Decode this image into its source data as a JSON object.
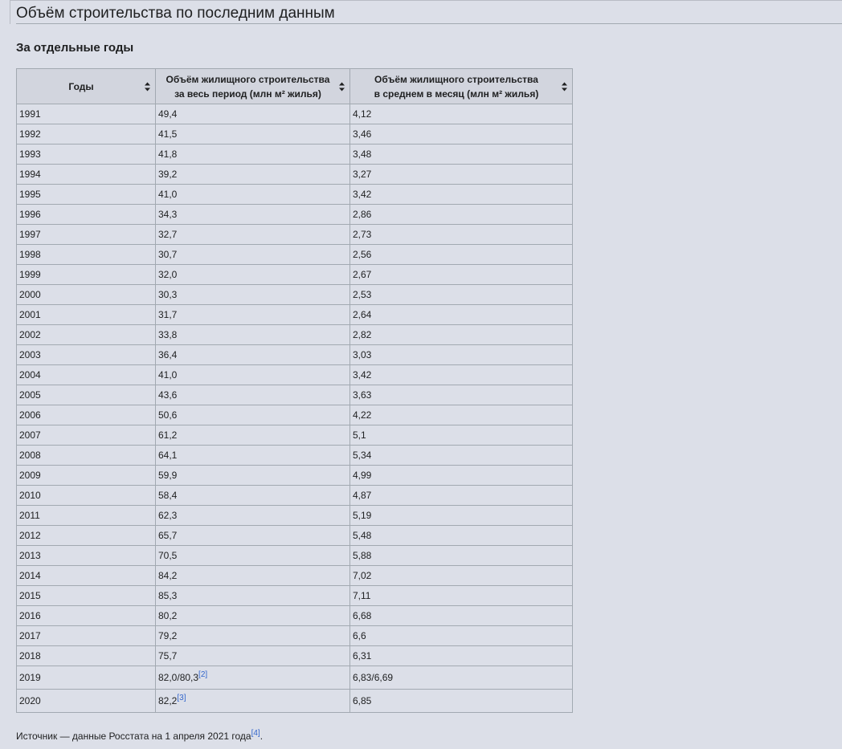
{
  "section_title": "Объём строительства по последним данным",
  "subsection_title": "За отдельные годы",
  "table": {
    "headers": [
      {
        "line1": "Годы",
        "line2": ""
      },
      {
        "line1": "Объём жилищного строительства",
        "line2": "за весь период (млн м² жилья)"
      },
      {
        "line1": "Объём жилищного строительства",
        "line2": "в среднем в месяц (млн м² жилья)"
      }
    ],
    "rows": [
      {
        "year": "1991",
        "total": "49,4",
        "total_ref": "",
        "monthly": "4,12"
      },
      {
        "year": "1992",
        "total": "41,5",
        "total_ref": "",
        "monthly": "3,46"
      },
      {
        "year": "1993",
        "total": "41,8",
        "total_ref": "",
        "monthly": "3,48"
      },
      {
        "year": "1994",
        "total": "39,2",
        "total_ref": "",
        "monthly": "3,27"
      },
      {
        "year": "1995",
        "total": "41,0",
        "total_ref": "",
        "monthly": "3,42"
      },
      {
        "year": "1996",
        "total": "34,3",
        "total_ref": "",
        "monthly": "2,86"
      },
      {
        "year": "1997",
        "total": "32,7",
        "total_ref": "",
        "monthly": "2,73"
      },
      {
        "year": "1998",
        "total": "30,7",
        "total_ref": "",
        "monthly": "2,56"
      },
      {
        "year": "1999",
        "total": "32,0",
        "total_ref": "",
        "monthly": "2,67"
      },
      {
        "year": "2000",
        "total": "30,3",
        "total_ref": "",
        "monthly": "2,53"
      },
      {
        "year": "2001",
        "total": "31,7",
        "total_ref": "",
        "monthly": "2,64"
      },
      {
        "year": "2002",
        "total": "33,8",
        "total_ref": "",
        "monthly": "2,82"
      },
      {
        "year": "2003",
        "total": "36,4",
        "total_ref": "",
        "monthly": "3,03"
      },
      {
        "year": "2004",
        "total": "41,0",
        "total_ref": "",
        "monthly": "3,42"
      },
      {
        "year": "2005",
        "total": "43,6",
        "total_ref": "",
        "monthly": "3,63"
      },
      {
        "year": "2006",
        "total": "50,6",
        "total_ref": "",
        "monthly": "4,22"
      },
      {
        "year": "2007",
        "total": "61,2",
        "total_ref": "",
        "monthly": "5,1"
      },
      {
        "year": "2008",
        "total": "64,1",
        "total_ref": "",
        "monthly": "5,34"
      },
      {
        "year": "2009",
        "total": "59,9",
        "total_ref": "",
        "monthly": "4,99"
      },
      {
        "year": "2010",
        "total": "58,4",
        "total_ref": "",
        "monthly": "4,87"
      },
      {
        "year": "2011",
        "total": "62,3",
        "total_ref": "",
        "monthly": "5,19"
      },
      {
        "year": "2012",
        "total": "65,7",
        "total_ref": "",
        "monthly": "5,48"
      },
      {
        "year": "2013",
        "total": "70,5",
        "total_ref": "",
        "monthly": "5,88"
      },
      {
        "year": "2014",
        "total": "84,2",
        "total_ref": "",
        "monthly": "7,02"
      },
      {
        "year": "2015",
        "total": "85,3",
        "total_ref": "",
        "monthly": "7,11"
      },
      {
        "year": "2016",
        "total": "80,2",
        "total_ref": "",
        "monthly": "6,68"
      },
      {
        "year": "2017",
        "total": "79,2",
        "total_ref": "",
        "monthly": "6,6"
      },
      {
        "year": "2018",
        "total": "75,7",
        "total_ref": "",
        "monthly": "6,31"
      },
      {
        "year": "2019",
        "total": "82,0/80,3",
        "total_ref": "[2]",
        "monthly": "6,83/6,69"
      },
      {
        "year": "2020",
        "total": "82,2",
        "total_ref": "[3]",
        "monthly": "6,85"
      }
    ]
  },
  "source": {
    "text": "Источник — данные Росстата на 1 апреля 2021 года",
    "ref": "[4]",
    "end": "."
  },
  "colors": {
    "background": "#dcdfe8",
    "header_background": "#d2d5de",
    "border": "#a2a9b1",
    "link": "#3366cc"
  },
  "icons": {
    "sort": "sort-icon"
  }
}
